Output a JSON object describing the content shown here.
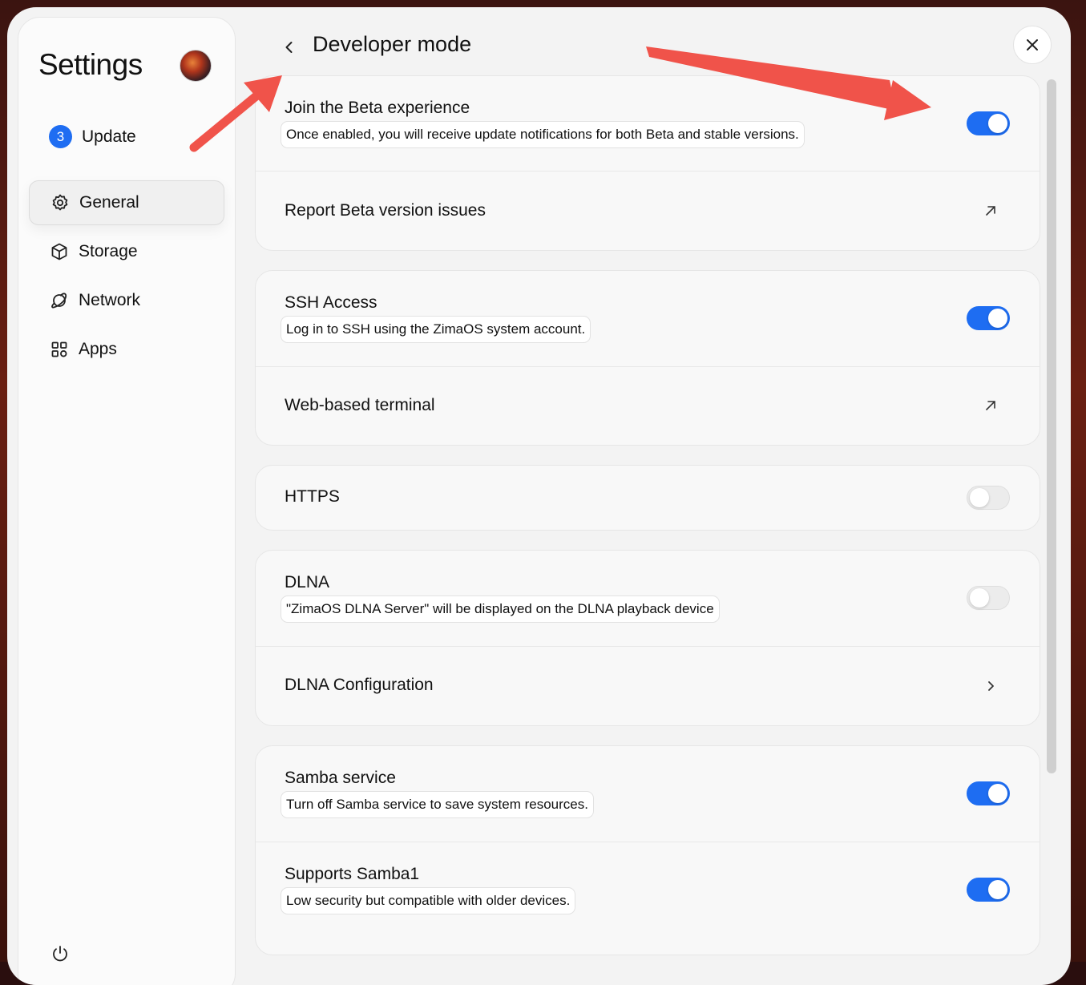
{
  "sidebar": {
    "title": "Settings",
    "update": {
      "count": "3",
      "label": "Update"
    },
    "items": [
      {
        "label": "General",
        "icon": "gear-icon",
        "active": true
      },
      {
        "label": "Storage",
        "icon": "box-icon"
      },
      {
        "label": "Network",
        "icon": "planet-icon"
      },
      {
        "label": "Apps",
        "icon": "grid-icon"
      }
    ],
    "footer_icon": "power-icon"
  },
  "header": {
    "title": "Developer mode"
  },
  "colors": {
    "accent": "#1e6df2",
    "annotation_arrow": "#f0534a"
  },
  "sections": [
    {
      "rows": [
        {
          "title": "Join the Beta experience",
          "desc": "Once enabled, you will receive update notifications for both Beta and stable versions.",
          "toggle": true
        },
        {
          "title": "Report Beta version issues",
          "trailing": "external-link-icon"
        }
      ]
    },
    {
      "rows": [
        {
          "title": "SSH Access",
          "desc": "Log in to SSH using the ZimaOS system account.",
          "toggle": true
        },
        {
          "title": "Web-based terminal",
          "trailing": "external-link-icon"
        }
      ]
    },
    {
      "rows": [
        {
          "title": "HTTPS",
          "toggle": false
        }
      ]
    },
    {
      "rows": [
        {
          "title": "DLNA",
          "desc": "\"ZimaOS DLNA Server\" will be displayed on the DLNA playback device",
          "toggle": false
        },
        {
          "title": "DLNA Configuration",
          "trailing": "chevron-right-icon"
        }
      ]
    },
    {
      "rows": [
        {
          "title": "Samba service",
          "desc": "Turn off Samba service to save system resources.",
          "toggle": true
        },
        {
          "title": "Supports Samba1",
          "desc": "Low security but compatible with older devices.",
          "toggle": true
        }
      ]
    }
  ]
}
